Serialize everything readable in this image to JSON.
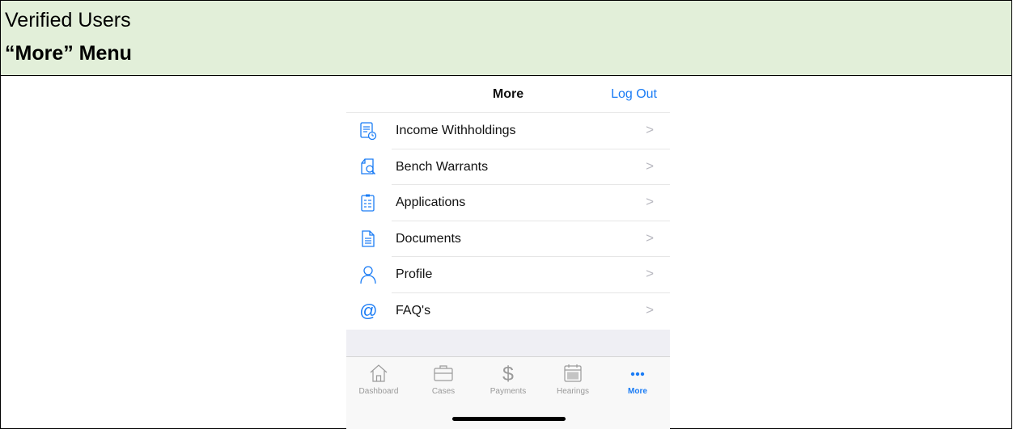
{
  "document": {
    "header_title": "Verified Users",
    "header_subtitle": "“More” Menu"
  },
  "nav": {
    "title": "More",
    "logout_label": "Log Out"
  },
  "menu": {
    "items": [
      {
        "label": "Income Withholdings",
        "icon": "ledger-icon"
      },
      {
        "label": "Bench Warrants",
        "icon": "document-search-icon"
      },
      {
        "label": "Applications",
        "icon": "clipboard-icon"
      },
      {
        "label": "Documents",
        "icon": "document-icon"
      },
      {
        "label": "Profile",
        "icon": "person-icon"
      },
      {
        "label": "FAQ's",
        "icon": "at-sign-icon"
      }
    ],
    "chevron": ">"
  },
  "tabs": {
    "items": [
      {
        "label": "Dashboard",
        "icon": "house-icon",
        "active": false
      },
      {
        "label": "Cases",
        "icon": "briefcase-icon",
        "active": false
      },
      {
        "label": "Payments",
        "icon": "dollar-icon",
        "active": false
      },
      {
        "label": "Hearings",
        "icon": "calendar-icon",
        "active": false
      },
      {
        "label": "More",
        "icon": "ellipsis-icon",
        "active": true
      }
    ]
  },
  "colors": {
    "accent": "#1a7cf5",
    "header_background": "#e2efd9",
    "inactive_tab": "#999999"
  }
}
